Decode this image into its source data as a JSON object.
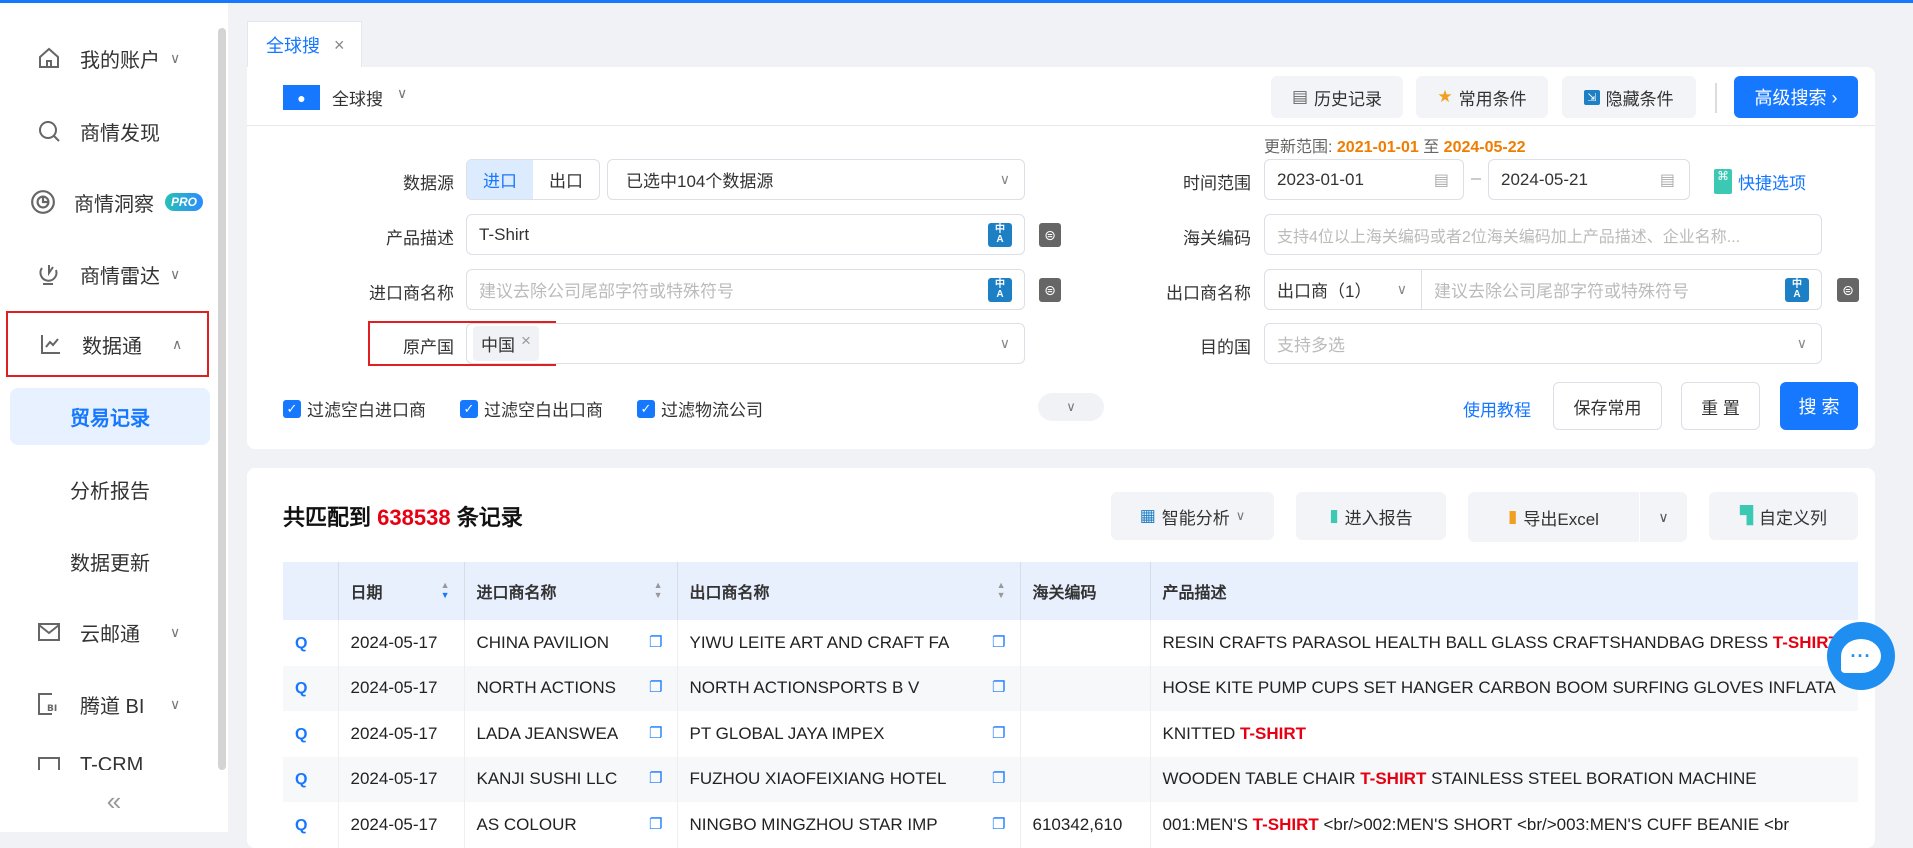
{
  "sidebar": {
    "items": [
      {
        "label": "我的账户",
        "icon": "home-icon"
      },
      {
        "label": "商情发现",
        "icon": "search-icon"
      },
      {
        "label": "商情洞察",
        "icon": "insight-icon",
        "badge": "PRO"
      },
      {
        "label": "商情雷达",
        "icon": "radar-icon"
      },
      {
        "label": "数据通",
        "icon": "chart-line-icon"
      },
      {
        "label": "云邮通",
        "icon": "mail-icon"
      },
      {
        "label": "腾道 BI",
        "icon": "bi-icon"
      },
      {
        "label": "T-CRM",
        "icon": "crm-icon"
      }
    ],
    "sub": [
      "贸易记录",
      "分析报告",
      "数据更新"
    ],
    "collapse": "«"
  },
  "tab": {
    "label": "全球搜",
    "close": "×"
  },
  "header": {
    "scope": "全球搜",
    "history": "历史记录",
    "common": "常用条件",
    "hide": "隐藏条件",
    "advanced": "高级搜索 ›"
  },
  "form": {
    "update_label": "更新范围:",
    "update_from": "2021-01-01",
    "update_sep": "至",
    "update_to": "2024-05-22",
    "datasource_label": "数据源",
    "import": "进口",
    "export": "出口",
    "datasource_value": "已选中104个数据源",
    "product_label": "产品描述",
    "product_value": "T-Shirt",
    "importer_label": "进口商名称",
    "importer_placeholder": "建议去除公司尾部字符或特殊符号",
    "origin_label": "原产国",
    "origin_tag": "中国",
    "time_label": "时间范围",
    "date_from": "2023-01-01",
    "date_to": "2024-05-21",
    "quick": "快捷选项",
    "hs_label": "海关编码",
    "hs_placeholder": "支持4位以上海关编码或者2位海关编码加上产品描述、企业名称...",
    "exporter_label": "出口商名称",
    "exporter_select": "出口商（1）",
    "exporter_placeholder": "建议去除公司尾部字符或特殊符号",
    "dest_label": "目的国",
    "dest_placeholder": "支持多选",
    "filters": [
      "过滤空白进口商",
      "过滤空白出口商",
      "过滤物流公司"
    ],
    "tutorial": "使用教程",
    "save": "保存常用",
    "reset": "重 置",
    "search": "搜 索"
  },
  "results": {
    "prefix": "共匹配到",
    "count": "638538",
    "suffix": "条记录",
    "smart": "智能分析",
    "report": "进入报告",
    "excel": "导出Excel",
    "columns": "自定义列",
    "headers": [
      "日期",
      "进口商名称",
      "出口商名称",
      "海关编码",
      "产品描述"
    ],
    "rows": [
      {
        "date": "2024-05-17",
        "importer": "CHINA PAVILION",
        "exporter": "YIWU LEITE ART AND CRAFT FA",
        "hs": "",
        "desc": [
          {
            "t": "RESIN CRAFTS PARASOL HEALTH BALL GLASS CRAFTSHANDBAG DRESS "
          },
          {
            "t": "T-SHIRT",
            "hl": true
          }
        ]
      },
      {
        "date": "2024-05-17",
        "importer": "NORTH ACTIONS",
        "exporter": "NORTH ACTIONSPORTS B V",
        "hs": "",
        "desc": [
          {
            "t": "HOSE KITE PUMP CUPS SET HANGER CARBON BOOM SURFING GLOVES INFLATA"
          }
        ]
      },
      {
        "date": "2024-05-17",
        "importer": "LADA JEANSWEA",
        "exporter": "PT GLOBAL JAYA IMPEX",
        "hs": "",
        "desc": [
          {
            "t": "KNITTED "
          },
          {
            "t": "T-SHIRT",
            "hl": true
          }
        ]
      },
      {
        "date": "2024-05-17",
        "importer": "KANJI SUSHI LLC",
        "exporter": "FUZHOU XIAOFEIXIANG HOTEL",
        "hs": "",
        "desc": [
          {
            "t": "WOODEN TABLE CHAIR "
          },
          {
            "t": "T-SHIRT",
            "hl": true
          },
          {
            "t": " STAINLESS STEEL BORATION MACHINE"
          }
        ]
      },
      {
        "date": "2024-05-17",
        "importer": "AS COLOUR",
        "exporter": "NINGBO MINGZHOU STAR IMP",
        "hs": "610342,610",
        "desc": [
          {
            "t": "001:MEN'S "
          },
          {
            "t": "T-SHIRT",
            "hl": true
          },
          {
            "t": " <br/>002:MEN'S SHORT <br/>003:MEN'S CUFF BEANIE <br"
          }
        ]
      }
    ]
  },
  "colors": {
    "primary": "#1677ff",
    "highlight": "#e60012",
    "orange": "#f07c00"
  }
}
